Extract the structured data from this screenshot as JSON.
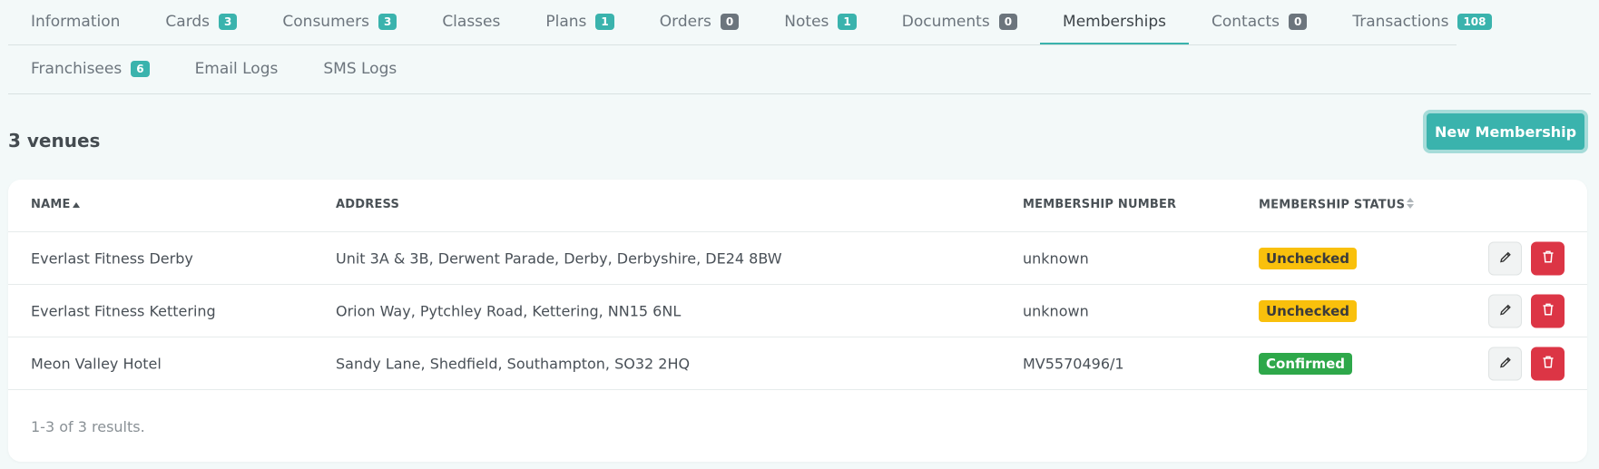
{
  "tabs_row1": [
    {
      "label": "Information",
      "badge": "",
      "badge_color": ""
    },
    {
      "label": "Cards",
      "badge": "3",
      "badge_color": "teal"
    },
    {
      "label": "Consumers",
      "badge": "3",
      "badge_color": "teal"
    },
    {
      "label": "Classes",
      "badge": "",
      "badge_color": ""
    },
    {
      "label": "Plans",
      "badge": "1",
      "badge_color": "teal"
    },
    {
      "label": "Orders",
      "badge": "0",
      "badge_color": "grey"
    },
    {
      "label": "Notes",
      "badge": "1",
      "badge_color": "teal"
    },
    {
      "label": "Documents",
      "badge": "0",
      "badge_color": "grey"
    },
    {
      "label": "Memberships",
      "badge": "",
      "badge_color": "",
      "active": true
    },
    {
      "label": "Contacts",
      "badge": "0",
      "badge_color": "grey"
    },
    {
      "label": "Transactions",
      "badge": "108",
      "badge_color": "teal"
    }
  ],
  "tabs_row2": [
    {
      "label": "Franchisees",
      "badge": "6",
      "badge_color": "teal"
    },
    {
      "label": "Email Logs",
      "badge": "",
      "badge_color": ""
    },
    {
      "label": "SMS Logs",
      "badge": "",
      "badge_color": ""
    }
  ],
  "summary": {
    "venue_count": "3 venues"
  },
  "actions": {
    "new_membership": "New Membership"
  },
  "table": {
    "headers": {
      "name": "NAME",
      "address": "ADDRESS",
      "membership_number": "MEMBERSHIP NUMBER",
      "membership_status": "MEMBERSHIP STATUS"
    },
    "rows": [
      {
        "name": "Everlast Fitness Derby",
        "address": "Unit 3A & 3B, Derwent Parade, Derby, Derbyshire, DE24 8BW",
        "membership_number": "unknown",
        "status": "Unchecked",
        "status_type": "unchecked"
      },
      {
        "name": "Everlast Fitness Kettering",
        "address": "Orion Way, Pytchley Road, Kettering, NN15 6NL",
        "membership_number": "unknown",
        "status": "Unchecked",
        "status_type": "unchecked"
      },
      {
        "name": "Meon Valley Hotel",
        "address": "Sandy Lane, Shedfield, Southampton, SO32 2HQ",
        "membership_number": "MV5570496/1",
        "status": "Confirmed",
        "status_type": "confirmed"
      }
    ],
    "footer": "1-3 of 3 results."
  },
  "icons": {
    "edit": "pencil-icon",
    "delete": "trash-icon",
    "sort_asc": "sort-ascending-icon",
    "sort_both": "sort-icon"
  },
  "colors": {
    "accent": "#3ab3ad",
    "unchecked": "#f9c00c",
    "confirmed": "#2ea84a",
    "danger": "#dc3545",
    "badge_grey": "#6c757d"
  }
}
